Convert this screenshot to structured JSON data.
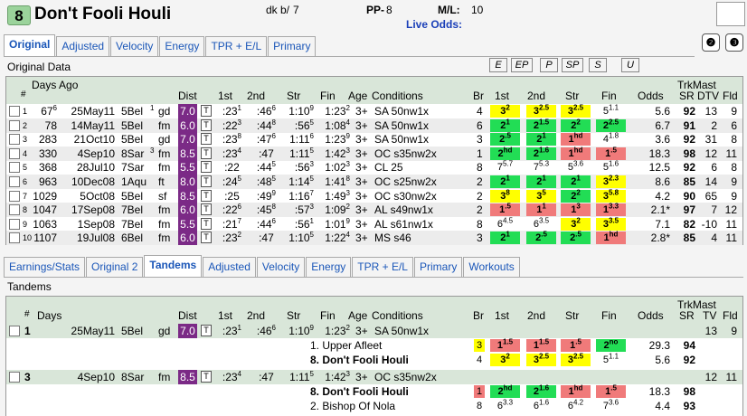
{
  "header": {
    "post_position": "8",
    "horse_name": "Don't Fooli Houli",
    "sire_label": "dk b/",
    "age": "7",
    "pp_label": "PP-",
    "pp_value": "8",
    "ml_label": "M/L:",
    "ml_value": "10",
    "live_odds_label": "Live Odds:",
    "round_buttons": [
      "2",
      "3"
    ]
  },
  "top_tabs": [
    "Original",
    "Adjusted",
    "Velocity",
    "Energy",
    "TPR + E/L",
    "Primary"
  ],
  "top_active_tab": "Original",
  "original": {
    "section_label": "Original Data",
    "filter_buttons": [
      "E",
      "EP",
      "P",
      "SP",
      "S",
      "U"
    ],
    "headers": {
      "num": "#",
      "days_ago": "Days Ago",
      "dist": "Dist",
      "first": "1st",
      "second": "2nd",
      "str": "Str",
      "fin": "Fin",
      "age": "Age",
      "conditions": "Conditions",
      "br": "Br",
      "p1": "1st",
      "p2": "2nd",
      "pstr": "Str",
      "pfin": "Fin",
      "odds": "Odds",
      "trkmast": "TrkMast",
      "sr": "SR",
      "dtv": "DTV",
      "fld": "Fld"
    },
    "rows": [
      {
        "n": "1",
        "days": "67",
        "days_sup": "6",
        "date": "25May11",
        "trk": "5Bel",
        "sup": "1",
        "cond": "gd",
        "dist": "7.0",
        "f1": ":23",
        "f1s": "1",
        "f2": ":46",
        "f2s": "6",
        "fs": "1:10",
        "fss": "9",
        "ff": "1:23",
        "ffs": "2",
        "age": "3+",
        "race": "SA 50nw1x",
        "br": "4",
        "p1": "3",
        "p1s": "2",
        "p1c": "cy",
        "p2": "3",
        "p2s": "2.5",
        "p2c": "cy",
        "ps": "3",
        "pss": "2.5",
        "psc": "cy",
        "pf": "5",
        "pfs": "1.1",
        "pfc": "",
        "odds": "5.6",
        "sr": "92",
        "dtv": "13",
        "fld": "9"
      },
      {
        "n": "2",
        "days": "78",
        "days_sup": "",
        "date": "14May11",
        "trk": "5Bel",
        "sup": "",
        "cond": "fm",
        "dist": "6.0",
        "f1": ":22",
        "f1s": "3",
        "f2": ":44",
        "f2s": "8",
        "fs": ":56",
        "fss": "5",
        "ff": "1:08",
        "ffs": "4",
        "age": "3+",
        "race": "SA 50nw1x",
        "br": "6",
        "p1": "2",
        "p1s": "1",
        "p1c": "cg",
        "p2": "2",
        "p2s": "1.5",
        "p2c": "cg",
        "ps": "2",
        "pss": "2",
        "psc": "cg",
        "pf": "2",
        "pfs": "2.5",
        "pfc": "cg",
        "odds": "6.7",
        "sr": "91",
        "dtv": "2",
        "fld": "6"
      },
      {
        "n": "3",
        "days": "283",
        "days_sup": "",
        "date": "21Oct10",
        "trk": "5Bel",
        "sup": "",
        "cond": "gd",
        "dist": "7.0",
        "f1": ":23",
        "f1s": "8",
        "f2": ":47",
        "f2s": "6",
        "fs": "1:11",
        "fss": "6",
        "ff": "1:23",
        "ffs": "9",
        "age": "3+",
        "race": "SA 50nw1x",
        "br": "3",
        "p1": "2",
        "p1s": ".5",
        "p1c": "cg",
        "p2": "2",
        "p2s": "1",
        "p2c": "cg",
        "ps": "1",
        "pss": "hd",
        "psc": "cr",
        "pf": "4",
        "pfs": "1.8",
        "pfc": "",
        "odds": "3.6",
        "sr": "92",
        "dtv": "31",
        "fld": "8"
      },
      {
        "n": "4",
        "days": "330",
        "days_sup": "",
        "date": "4Sep10",
        "trk": "8Sar",
        "sup": "3",
        "cond": "fm",
        "dist": "8.5",
        "f1": ":23",
        "f1s": "4",
        "f2": ":47",
        "f2s": "",
        "fs": "1:11",
        "fss": "5",
        "ff": "1:42",
        "ffs": "3",
        "age": "3+",
        "race": "OC s35nw2x",
        "br": "1",
        "p1": "2",
        "p1s": "hd",
        "p1c": "cg",
        "p2": "2",
        "p2s": "1.6",
        "p2c": "cg",
        "ps": "1",
        "pss": "hd",
        "psc": "cr",
        "pf": "1",
        "pfs": ".5",
        "pfc": "cr",
        "odds": "18.3",
        "sr": "98",
        "dtv": "12",
        "fld": "11"
      },
      {
        "n": "5",
        "days": "368",
        "days_sup": "",
        "date": "28Jul10",
        "trk": "7Sar",
        "sup": "",
        "cond": "fm",
        "dist": "5.5",
        "f1": ":22",
        "f1s": "",
        "f2": ":44",
        "f2s": "5",
        "fs": ":56",
        "fss": "3",
        "ff": "1:02",
        "ffs": "3",
        "age": "3+",
        "race": "CL 25",
        "br": "8",
        "p1": "7",
        "p1s": "5.7",
        "p1c": "",
        "p2": "7",
        "p2s": "5.3",
        "p2c": "",
        "ps": "5",
        "pss": "3.6",
        "psc": "",
        "pf": "5",
        "pfs": "1.6",
        "pfc": "",
        "odds": "12.5",
        "sr": "92",
        "dtv": "6",
        "fld": "8"
      },
      {
        "n": "6",
        "days": "963",
        "days_sup": "",
        "date": "10Dec08",
        "trk": "1Aqu",
        "sup": "",
        "cond": "ft",
        "dist": "8.0",
        "f1": ":24",
        "f1s": "5",
        "f2": ":48",
        "f2s": "5",
        "fs": "1:14",
        "fss": "5",
        "ff": "1:41",
        "ffs": "8",
        "age": "3+",
        "race": "OC s25nw2x",
        "br": "2",
        "p1": "2",
        "p1s": "1",
        "p1c": "cg",
        "p2": "2",
        "p2s": "1",
        "p2c": "cg",
        "ps": "2",
        "pss": "1",
        "psc": "cg",
        "pf": "3",
        "pfs": "2.3",
        "pfc": "cy",
        "odds": "8.6",
        "sr": "85",
        "dtv": "14",
        "fld": "9"
      },
      {
        "n": "7",
        "days": "1029",
        "days_sup": "",
        "date": "5Oct08",
        "trk": "5Bel",
        "sup": "",
        "cond": "sf",
        "dist": "8.5",
        "f1": ":25",
        "f1s": "",
        "f2": ":49",
        "f2s": "9",
        "fs": "1:16",
        "fss": "7",
        "ff": "1:49",
        "ffs": "3",
        "age": "3+",
        "race": "OC s30nw2x",
        "br": "2",
        "p1": "3",
        "p1s": "8",
        "p1c": "cy",
        "p2": "3",
        "p2s": "5",
        "p2c": "cy",
        "ps": "2",
        "pss": "2",
        "psc": "cg",
        "pf": "3",
        "pfs": "5.8",
        "pfc": "cy",
        "odds": "4.2",
        "sr": "90",
        "dtv": "65",
        "fld": "9"
      },
      {
        "n": "8",
        "days": "1047",
        "days_sup": "",
        "date": "17Sep08",
        "trk": "7Bel",
        "sup": "",
        "cond": "fm",
        "dist": "6.0",
        "f1": ":22",
        "f1s": "6",
        "f2": ":45",
        "f2s": "8",
        "fs": ":57",
        "fss": "3",
        "ff": "1:09",
        "ffs": "2",
        "age": "3+",
        "race": "AL s49nw1x",
        "br": "2",
        "p1": "1",
        "p1s": ".5",
        "p1c": "cr",
        "p2": "1",
        "p2s": "1",
        "p2c": "cr",
        "ps": "1",
        "pss": "3",
        "psc": "cr",
        "pf": "1",
        "pfs": "3.3",
        "pfc": "cr",
        "odds": "2.1*",
        "sr": "97",
        "dtv": "7",
        "fld": "12"
      },
      {
        "n": "9",
        "days": "1063",
        "days_sup": "",
        "date": "1Sep08",
        "trk": "7Bel",
        "sup": "",
        "cond": "fm",
        "dist": "5.5",
        "f1": ":21",
        "f1s": "7",
        "f2": ":44",
        "f2s": "6",
        "fs": ":56",
        "fss": "1",
        "ff": "1:01",
        "ffs": "9",
        "age": "3+",
        "race": "AL s61nw1x",
        "br": "8",
        "p1": "6",
        "p1s": "4.5",
        "p1c": "",
        "p2": "6",
        "p2s": "3.5",
        "p2c": "",
        "ps": "3",
        "pss": "2",
        "psc": "cy",
        "pf": "3",
        "pfs": "3.5",
        "pfc": "cy",
        "odds": "7.1",
        "sr": "82",
        "dtv": "-10",
        "fld": "11"
      },
      {
        "n": "10",
        "days": "1107",
        "days_sup": "",
        "date": "19Jul08",
        "trk": "6Bel",
        "sup": "",
        "cond": "fm",
        "dist": "6.0",
        "f1": ":23",
        "f1s": "2",
        "f2": ":47",
        "f2s": "",
        "fs": "1:10",
        "fss": "5",
        "ff": "1:22",
        "ffs": "4",
        "age": "3+",
        "race": "MS s46",
        "br": "3",
        "p1": "2",
        "p1s": "1",
        "p1c": "cg",
        "p2": "2",
        "p2s": ".5",
        "p2c": "cg",
        "ps": "2",
        "pss": ".5",
        "psc": "cg",
        "pf": "1",
        "pfs": "hd",
        "pfc": "cr",
        "odds": "2.8*",
        "sr": "85",
        "dtv": "4",
        "fld": "11"
      }
    ]
  },
  "bottom_tabs": [
    "Earnings/Stats",
    "Original 2",
    "Tandems",
    "Adjusted",
    "Velocity",
    "Energy",
    "TPR + E/L",
    "Primary",
    "Workouts"
  ],
  "bottom_active_tab": "Tandems",
  "tandems": {
    "section_label": "Tandems",
    "headers": {
      "num": "#",
      "days": "Days",
      "dist": "Dist",
      "first": "1st",
      "second": "2nd",
      "str": "Str",
      "fin": "Fin",
      "age": "Age",
      "conditions": "Conditions",
      "br": "Br",
      "p1": "1st",
      "p2": "2nd",
      "pstr": "Str",
      "pfin": "Fin",
      "odds": "Odds",
      "trkmast": "TrkMast",
      "sr": "SR",
      "tv": "TV",
      "fld": "Fld"
    },
    "groups": [
      {
        "n": "1",
        "date": "25May11",
        "trk": "5Bel",
        "cond": "gd",
        "dist": "7.0",
        "f1": ":23",
        "f1s": "1",
        "f2": ":46",
        "f2s": "6",
        "fs": "1:10",
        "fss": "9",
        "ff": "1:23",
        "ffs": "2",
        "age": "3+",
        "race": "SA 50nw1x",
        "tv": "13",
        "fld": "9",
        "horses": [
          {
            "label": "1.  Upper Afleet",
            "bold": false,
            "br": "3",
            "brc": "cy",
            "p1": "1",
            "p1s": "1.5",
            "p1c": "cr",
            "p2": "1",
            "p2s": "1.5",
            "p2c": "cr",
            "ps": "1",
            "pss": ".5",
            "psc": "cr",
            "pf": "2",
            "pfs": "no",
            "pfc": "cg",
            "odds": "29.3",
            "sr": "94"
          },
          {
            "label": "8.  Don't Fooli Houli",
            "bold": true,
            "br": "4",
            "brc": "",
            "p1": "3",
            "p1s": "2",
            "p1c": "cy",
            "p2": "3",
            "p2s": "2.5",
            "p2c": "cy",
            "ps": "3",
            "pss": "2.5",
            "psc": "cy",
            "pf": "5",
            "pfs": "1.1",
            "pfc": "",
            "odds": "5.6",
            "sr": "92"
          }
        ]
      },
      {
        "n": "3",
        "date": "4Sep10",
        "trk": "8Sar",
        "cond": "fm",
        "dist": "8.5",
        "f1": ":23",
        "f1s": "4",
        "f2": ":47",
        "f2s": "",
        "fs": "1:11",
        "fss": "5",
        "ff": "1:42",
        "ffs": "3",
        "age": "3+",
        "race": "OC s35nw2x",
        "tv": "12",
        "fld": "11",
        "horses": [
          {
            "label": "8.  Don't Fooli Houli",
            "bold": true,
            "br": "1",
            "brc": "cr",
            "p1": "2",
            "p1s": "hd",
            "p1c": "cg",
            "p2": "2",
            "p2s": "1.6",
            "p2c": "cg",
            "ps": "1",
            "pss": "hd",
            "psc": "cr",
            "pf": "1",
            "pfs": ".5",
            "pfc": "cr",
            "odds": "18.3",
            "sr": "98"
          },
          {
            "label": "2.  Bishop Of Nola",
            "bold": false,
            "br": "8",
            "brc": "",
            "p1": "6",
            "p1s": "3.3",
            "p1c": "",
            "p2": "6",
            "p2s": "1.6",
            "p2c": "",
            "ps": "6",
            "pss": "4.2",
            "psc": "",
            "pf": "7",
            "pfs": "3.6",
            "pfc": "",
            "odds": "4.4",
            "sr": "93"
          }
        ]
      }
    ]
  },
  "colors": {
    "dist_bg": "#7b2a86",
    "header_green": "#d9e6d9",
    "yellow": "#ffff00",
    "green": "#22dd55",
    "red": "#f07a7a",
    "tab_text": "#1a56b8"
  }
}
